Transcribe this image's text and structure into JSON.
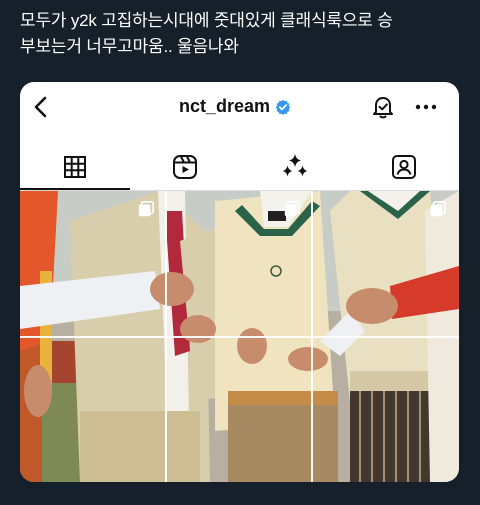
{
  "tweet": {
    "line1": "모두가 y2k 고집하는시대에 줏대있게 클래식룩으로 승",
    "line2": "부보는거 너무고마움.. 울음나와"
  },
  "instagram": {
    "username": "nct_dream",
    "verified": true,
    "header_icons": [
      "back-arrow-icon",
      "verified-badge-icon",
      "notification-bell-icon",
      "more-options-icon"
    ],
    "tabs": [
      {
        "name": "posts-grid",
        "icon": "grid-icon",
        "active": true
      },
      {
        "name": "reels",
        "icon": "reels-icon",
        "active": false
      },
      {
        "name": "sparkle",
        "icon": "sparkle-icon",
        "active": false
      },
      {
        "name": "tagged",
        "icon": "tagged-person-icon",
        "active": false
      }
    ],
    "grid": {
      "rows": 2,
      "columns": 3,
      "thumbnail_badges": [
        "multi-post-icon",
        "multi-post-icon",
        "multi-post-icon"
      ]
    }
  },
  "colors": {
    "page_background": "#15202b",
    "tweet_text": "#ffffff",
    "card_background": "#ffffff",
    "verified_blue": "#3897f0",
    "icon_dark": "#111111"
  }
}
